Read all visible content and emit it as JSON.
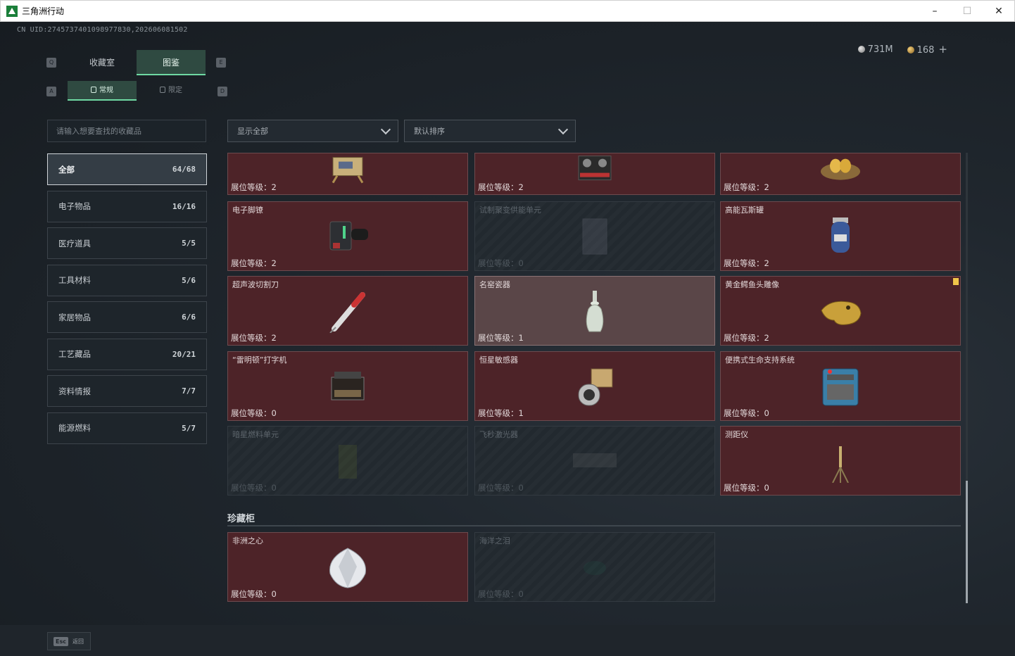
{
  "window": {
    "title": "三角洲行动",
    "minimize": "–",
    "maximize": "☐",
    "close": "✕"
  },
  "header": {
    "uid": "CN UID:2745737401098977830,202606081502",
    "silver_amount": "731M",
    "gold_amount": "168",
    "plus": "+"
  },
  "tabs": {
    "main": [
      {
        "label": "收藏室",
        "key": "Q"
      },
      {
        "label": "图鉴",
        "key": "E"
      }
    ],
    "sub": [
      {
        "label": "常规",
        "key": "A"
      },
      {
        "label": "限定",
        "key": "D"
      }
    ]
  },
  "search": {
    "placeholder": "请输入想要查找的收藏品"
  },
  "categories": [
    {
      "label": "全部",
      "count": "64/68"
    },
    {
      "label": "电子物品",
      "count": "16/16"
    },
    {
      "label": "医疗道具",
      "count": "5/5"
    },
    {
      "label": "工具材料",
      "count": "5/6"
    },
    {
      "label": "家居物品",
      "count": "6/6"
    },
    {
      "label": "工艺藏品",
      "count": "20/21"
    },
    {
      "label": "资料情报",
      "count": "7/7"
    },
    {
      "label": "能源燃料",
      "count": "5/7"
    }
  ],
  "filters": {
    "show": "显示全部",
    "sort": "默认排序"
  },
  "level_label": "展位等级：",
  "items": [
    {
      "name": "",
      "level": "2",
      "icon": "circuit-board-icon",
      "state": "owned"
    },
    {
      "name": "",
      "level": "2",
      "icon": "tape-recorder-icon",
      "state": "owned"
    },
    {
      "name": "",
      "level": "2",
      "icon": "golden-egg-nest-icon",
      "state": "owned"
    },
    {
      "name": "电子脚镣",
      "level": "2",
      "icon": "ankle-monitor-icon",
      "state": "owned"
    },
    {
      "name": "试制聚变供能单元",
      "level": "0",
      "icon": "fusion-unit-icon",
      "state": "locked"
    },
    {
      "name": "高能瓦斯罐",
      "level": "2",
      "icon": "gas-canister-icon",
      "state": "owned"
    },
    {
      "name": "超声波切割刀",
      "level": "2",
      "icon": "ultrasonic-cutter-icon",
      "state": "owned"
    },
    {
      "name": "名窑瓷器",
      "level": "1",
      "icon": "porcelain-vase-icon",
      "state": "selected"
    },
    {
      "name": "黄金鳄鱼头雕像",
      "level": "2",
      "icon": "gold-crocodile-icon",
      "state": "owned"
    },
    {
      "name": "“雷明顿”打字机",
      "level": "0",
      "icon": "typewriter-icon",
      "state": "owned"
    },
    {
      "name": "恒星敏感器",
      "level": "1",
      "icon": "star-sensor-icon",
      "state": "owned"
    },
    {
      "name": "便携式生命支持系统",
      "level": "0",
      "icon": "life-support-icon",
      "state": "owned"
    },
    {
      "name": "暗星燃料单元",
      "level": "0",
      "icon": "fuel-cell-icon",
      "state": "locked"
    },
    {
      "name": "飞秒激光器",
      "level": "0",
      "icon": "laser-icon",
      "state": "locked"
    },
    {
      "name": "测距仪",
      "level": "0",
      "icon": "rangefinder-icon",
      "state": "owned"
    }
  ],
  "vault": {
    "title": "珍藏柜",
    "items": [
      {
        "name": "非洲之心",
        "level": "0",
        "icon": "diamond-icon",
        "state": "owned"
      },
      {
        "name": "海洋之泪",
        "level": "0",
        "icon": "gem-icon",
        "state": "locked"
      }
    ]
  },
  "footer": {
    "esc_key": "Esc",
    "back_label": "返回"
  }
}
